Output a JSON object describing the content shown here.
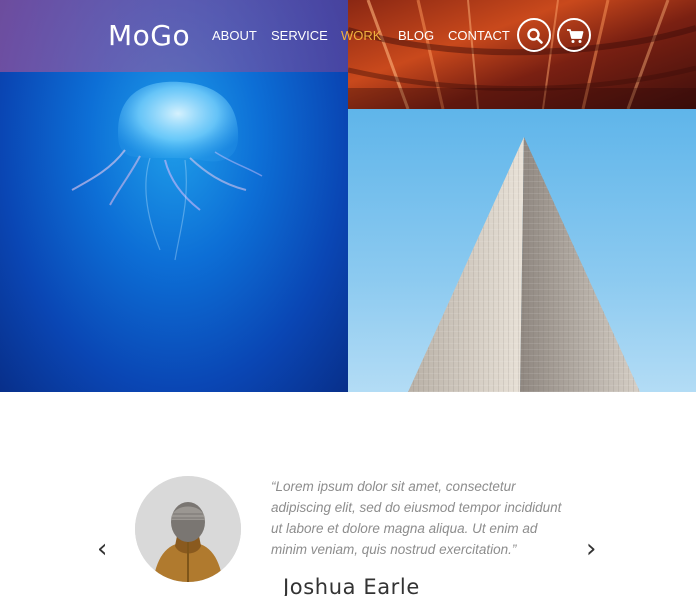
{
  "brand": {
    "logo": "MoGo"
  },
  "nav": {
    "items": [
      {
        "label": "ABOUT",
        "active": false
      },
      {
        "label": "SERVICE",
        "active": false
      },
      {
        "label": "WORK",
        "active": true
      },
      {
        "label": "BLOG",
        "active": false
      },
      {
        "label": "CONTACT",
        "active": false
      }
    ],
    "icons": [
      "search-icon",
      "cart-icon"
    ]
  },
  "gallery": {
    "images": [
      "jellyfish",
      "red-building",
      "skyscraper"
    ]
  },
  "testimonial": {
    "quote": "“Lorem ipsum dolor sit amet, consectetur adipiscing elit, sed do eiusmod tempor incididunt ut labore et dolore magna aliqua. Ut enim ad minim veniam, quis nostrud exercitation.”",
    "author": "Joshua Earle",
    "prev_label": "‹",
    "next_label": "›"
  },
  "colors": {
    "accent": "#f0b03e",
    "text_dark": "#333333",
    "text_muted": "#8d8d8d"
  }
}
